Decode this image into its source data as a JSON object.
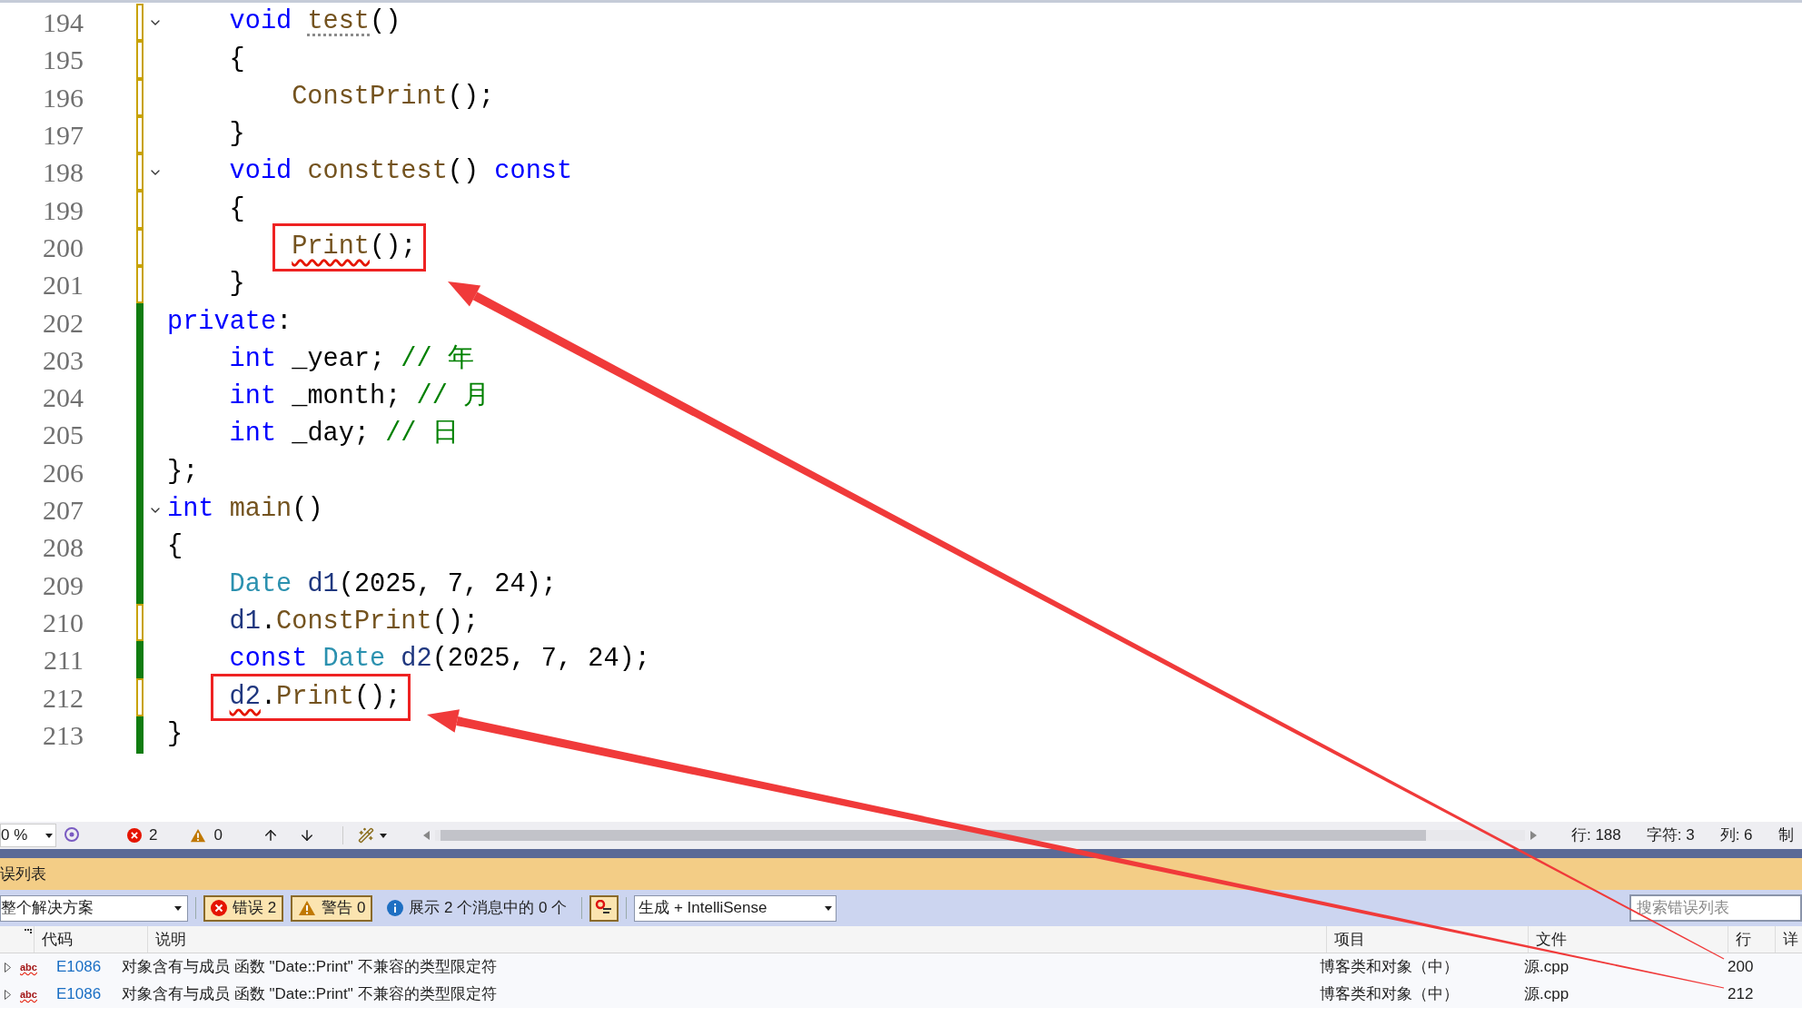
{
  "editor": {
    "lines": [
      {
        "number": "194",
        "foldable": true,
        "saved": false,
        "boxed": false,
        "indented": true,
        "nested": false,
        "tokens": [
          {
            "text": "void ",
            "kind": "keyword"
          },
          {
            "text": "test",
            "kind": "function",
            "hint_squiggle": true
          },
          {
            "text": "()",
            "kind": "plain"
          }
        ]
      },
      {
        "number": "195",
        "foldable": false,
        "saved": false,
        "boxed": false,
        "indented": true,
        "nested": false,
        "tokens": [
          {
            "text": "{",
            "kind": "plain"
          }
        ]
      },
      {
        "number": "196",
        "foldable": false,
        "saved": false,
        "boxed": false,
        "indented": true,
        "nested": true,
        "tokens": [
          {
            "text": "ConstPrint",
            "kind": "function"
          },
          {
            "text": "();",
            "kind": "plain"
          }
        ]
      },
      {
        "number": "197",
        "foldable": false,
        "saved": false,
        "boxed": false,
        "indented": true,
        "nested": false,
        "tokens": [
          {
            "text": "}",
            "kind": "plain"
          }
        ]
      },
      {
        "number": "198",
        "foldable": true,
        "saved": false,
        "boxed": false,
        "indented": true,
        "nested": false,
        "tokens": [
          {
            "text": "void ",
            "kind": "keyword"
          },
          {
            "text": "consttest",
            "kind": "function"
          },
          {
            "text": "() ",
            "kind": "plain"
          },
          {
            "text": "const",
            "kind": "keyword"
          }
        ]
      },
      {
        "number": "199",
        "foldable": false,
        "saved": false,
        "boxed": false,
        "indented": true,
        "nested": false,
        "tokens": [
          {
            "text": "{",
            "kind": "plain"
          }
        ]
      },
      {
        "number": "200",
        "foldable": false,
        "saved": false,
        "boxed": true,
        "indented": true,
        "nested": true,
        "tokens": [
          {
            "text": "Print",
            "kind": "function",
            "error_squiggle": true
          },
          {
            "text": "();",
            "kind": "plain"
          }
        ]
      },
      {
        "number": "201",
        "foldable": false,
        "saved": false,
        "boxed": false,
        "indented": true,
        "nested": false,
        "tokens": [
          {
            "text": "}",
            "kind": "plain"
          }
        ]
      },
      {
        "number": "202",
        "foldable": false,
        "saved": true,
        "boxed": false,
        "indented": false,
        "nested": false,
        "tokens": [
          {
            "text": "private",
            "kind": "keyword"
          },
          {
            "text": ":",
            "kind": "plain"
          }
        ]
      },
      {
        "number": "203",
        "foldable": false,
        "saved": true,
        "boxed": false,
        "indented": true,
        "nested": false,
        "tokens": [
          {
            "text": "int",
            "kind": "keyword"
          },
          {
            "text": " _year; ",
            "kind": "plain"
          },
          {
            "text": "// 年",
            "kind": "comment"
          }
        ]
      },
      {
        "number": "204",
        "foldable": false,
        "saved": true,
        "boxed": false,
        "indented": true,
        "nested": false,
        "tokens": [
          {
            "text": "int",
            "kind": "keyword"
          },
          {
            "text": " _month; ",
            "kind": "plain"
          },
          {
            "text": "// 月",
            "kind": "comment"
          }
        ]
      },
      {
        "number": "205",
        "foldable": false,
        "saved": true,
        "boxed": false,
        "indented": true,
        "nested": false,
        "tokens": [
          {
            "text": "int",
            "kind": "keyword"
          },
          {
            "text": " _day; ",
            "kind": "plain"
          },
          {
            "text": "// 日",
            "kind": "comment"
          }
        ]
      },
      {
        "number": "206",
        "foldable": false,
        "saved": true,
        "boxed": false,
        "indented": false,
        "nested": false,
        "tokens": [
          {
            "text": "};",
            "kind": "plain"
          }
        ]
      },
      {
        "number": "207",
        "foldable": true,
        "saved": true,
        "boxed": false,
        "indented": false,
        "nested": false,
        "tokens": [
          {
            "text": "int ",
            "kind": "keyword"
          },
          {
            "text": "main",
            "kind": "function"
          },
          {
            "text": "()",
            "kind": "plain"
          }
        ]
      },
      {
        "number": "208",
        "foldable": false,
        "saved": true,
        "boxed": false,
        "indented": false,
        "nested": false,
        "tokens": [
          {
            "text": "{",
            "kind": "plain"
          }
        ]
      },
      {
        "number": "209",
        "foldable": false,
        "saved": true,
        "boxed": false,
        "indented": true,
        "nested": false,
        "tokens": [
          {
            "text": "Date ",
            "kind": "type"
          },
          {
            "text": "d1",
            "kind": "variable"
          },
          {
            "text": "(2025, 7, 24);",
            "kind": "plain"
          }
        ]
      },
      {
        "number": "210",
        "foldable": false,
        "saved": false,
        "boxed": false,
        "indented": true,
        "nested": false,
        "tokens": [
          {
            "text": "d1",
            "kind": "variable"
          },
          {
            "text": ".",
            "kind": "plain"
          },
          {
            "text": "ConstPrint",
            "kind": "function"
          },
          {
            "text": "();",
            "kind": "plain"
          }
        ]
      },
      {
        "number": "211",
        "foldable": false,
        "saved": true,
        "boxed": false,
        "indented": true,
        "nested": false,
        "tokens": [
          {
            "text": "const ",
            "kind": "keyword"
          },
          {
            "text": "Date ",
            "kind": "type"
          },
          {
            "text": "d2",
            "kind": "variable"
          },
          {
            "text": "(2025, 7, 24);",
            "kind": "plain"
          }
        ]
      },
      {
        "number": "212",
        "foldable": false,
        "saved": false,
        "boxed": true,
        "indented": true,
        "nested": false,
        "tokens": [
          {
            "text": "d2",
            "kind": "variable",
            "error_squiggle": true
          },
          {
            "text": ".",
            "kind": "plain"
          },
          {
            "text": "Print",
            "kind": "function"
          },
          {
            "text": "();",
            "kind": "plain"
          }
        ]
      },
      {
        "number": "213",
        "foldable": false,
        "saved": true,
        "boxed": false,
        "indented": false,
        "nested": false,
        "tokens": [
          {
            "text": "}",
            "kind": "plain"
          }
        ]
      }
    ]
  },
  "status_bar": {
    "zoom": "0 %",
    "errors": "2",
    "warnings": "0",
    "line": "行: 188",
    "char": "字符: 3",
    "col": "列: 6",
    "extra": "制"
  },
  "error_list": {
    "title": "误列表",
    "scope": "整个解决方案",
    "filters": [
      {
        "label": "错误 2",
        "kind": "error",
        "selected": true
      },
      {
        "label": "警告 0",
        "kind": "warning",
        "selected": true
      },
      {
        "label": "展示 2 个消息中的 0 个",
        "kind": "info",
        "selected": false
      }
    ],
    "build_filter_selected": true,
    "build_filter": "生成 + IntelliSense",
    "search": {
      "placeholder": "搜索错误列表"
    },
    "columns": [
      "代码",
      "说明",
      "项目",
      "文件",
      "行",
      "详"
    ],
    "rows": [
      {
        "icon": "abc",
        "code": "E1086",
        "description": "对象含有与成员 函数 \"Date::Print\" 不兼容的类型限定符",
        "project": "博客类和对象（中）",
        "file": "源.cpp",
        "line": "200"
      },
      {
        "icon": "abc",
        "code": "E1086",
        "description": "对象含有与成员 函数 \"Date::Print\" 不兼容的类型限定符",
        "project": "博客类和对象（中）",
        "file": "源.cpp",
        "line": "212"
      }
    ]
  }
}
